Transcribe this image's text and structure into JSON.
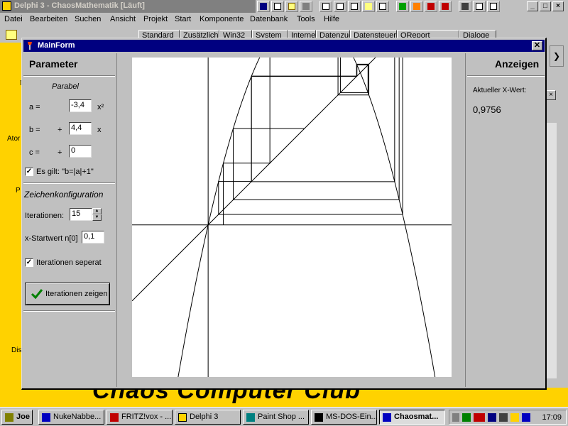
{
  "ide": {
    "title": "Delphi 3 - ChaosMathematik [Läuft]",
    "menu": [
      "Datei",
      "Bearbeiten",
      "Suchen",
      "Ansicht",
      "Projekt",
      "Start",
      "Komponente",
      "Datenbank",
      "Tools",
      "Hilfe"
    ],
    "palette_tabs": [
      "Standard",
      "Zusätzlich",
      "Win32",
      "System",
      "Internet",
      "Datenzugriff",
      "Datensteuerung",
      "QReport",
      "Dialoge"
    ],
    "bg_labels": [
      "N",
      "Ator",
      "P",
      "Dis"
    ],
    "logo_text": "Chaos Computer Club"
  },
  "mainform": {
    "title": "MainForm",
    "close": "✕",
    "left": {
      "header": "Parameter",
      "section_title": "Parabel",
      "a_label": "a =",
      "a_value": "-3,4",
      "a_suffix": "x²",
      "b_label": "b =",
      "b_sign": "+",
      "b_value": "4,4",
      "b_suffix": "x",
      "c_label": "c =",
      "c_sign": "+",
      "c_value": "0",
      "rule_check": "✓",
      "rule_label": "Es gilt: \"b=|a|+1\"",
      "config_title": "Zeichenkonfiguration",
      "iter_label": "Iterationen:",
      "iter_value": "15",
      "start_label": "x-Startwert n[0]",
      "start_value": "0,1",
      "sep_check": "✓",
      "sep_label": "Iterationen seperat",
      "show_button": "Iterationen zeigen"
    },
    "right": {
      "header": "Anzeigen",
      "current_label": "Aktueller X-Wert:",
      "current_value": "0,9756"
    }
  },
  "plot": {
    "parabola": {
      "a": -3.4,
      "b": 4.4,
      "c": 0
    },
    "iterations": 15,
    "x0": 0.1,
    "colors": {
      "line": "#000000",
      "background": "#ffffff"
    }
  },
  "taskbar": {
    "items": [
      "Joe",
      "NukeNabbe...",
      "FRITZ!vox - ...",
      "Delphi 3",
      "Paint Shop ...",
      "MS-DOS-Ein...",
      "Chaosmat..."
    ],
    "active_index": 6,
    "clock": "17:09"
  }
}
